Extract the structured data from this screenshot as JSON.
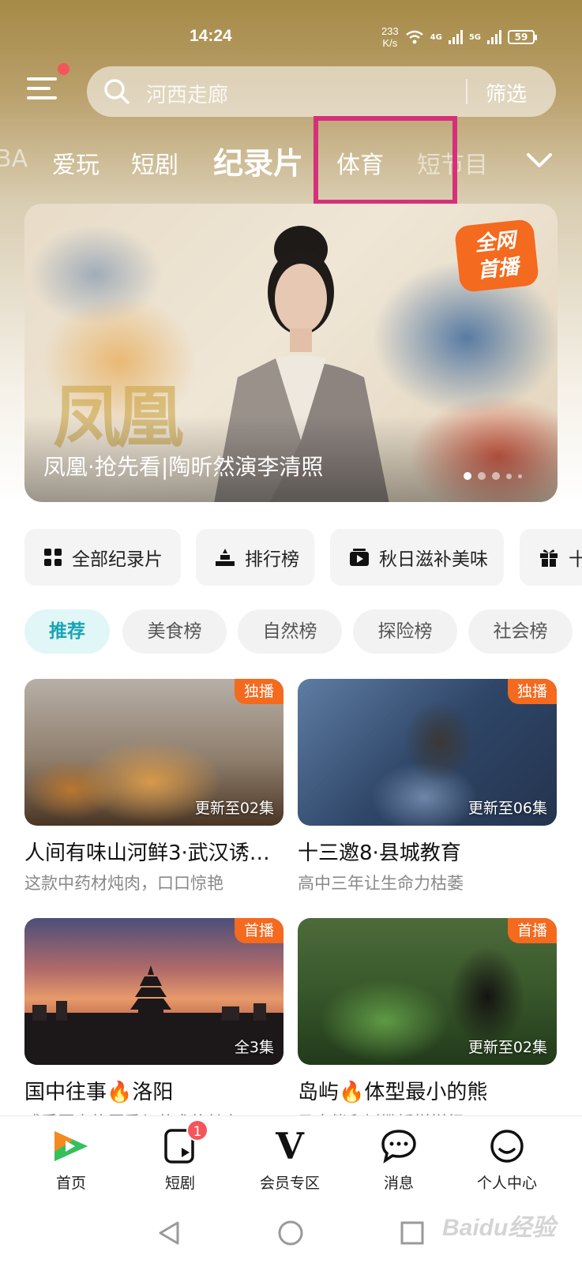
{
  "status_bar": {
    "time": "14:24",
    "net_speed_value": "233",
    "net_speed_unit": "K/s",
    "sig1_label": "4G",
    "sig2_label": "5G",
    "battery": "59"
  },
  "search": {
    "placeholder": "河西走廊",
    "filter_label": "筛选"
  },
  "tabs": [
    {
      "label": "BA"
    },
    {
      "label": "爱玩"
    },
    {
      "label": "短剧"
    },
    {
      "label": "纪录片",
      "active": true
    },
    {
      "label": "体育"
    },
    {
      "label": "短节目"
    }
  ],
  "banner": {
    "calligraphy": "凤凰",
    "badge_line1": "全网",
    "badge_line2": "首播",
    "caption": "凤凰·抢先看|陶昕然演李清照",
    "page_count": 5,
    "current_page": 1
  },
  "quick_entries": [
    {
      "label": "全部纪录片",
      "icon": "grid-icon"
    },
    {
      "label": "排行榜",
      "icon": "podium-icon"
    },
    {
      "label": "秋日滋补美味",
      "icon": "play-box-icon"
    },
    {
      "label": "十",
      "icon": "gift-icon"
    }
  ],
  "rank_chips": [
    {
      "label": "推荐",
      "active": true
    },
    {
      "label": "美食榜"
    },
    {
      "label": "自然榜"
    },
    {
      "label": "探险榜"
    },
    {
      "label": "社会榜"
    }
  ],
  "cards": [
    {
      "tag": "独播",
      "episode": "更新至02集",
      "title": "人间有味山河鲜3·武汉诱…",
      "subtitle": "这款中药材炖肉，口口惊艳"
    },
    {
      "tag": "独播",
      "episode": "更新至06集",
      "title": "十三邀8·县城教育",
      "subtitle": "高中三年让生命力枯萎"
    },
    {
      "tag": "首播",
      "episode": "全3集",
      "title_a": "国中往事",
      "title_b": "洛阳",
      "subtitle": "感受历史的厚重与艺术的魅力"
    },
    {
      "tag": "首播",
      "episode": "更新至02集",
      "title_a": "岛屿",
      "title_b": "体型最小的熊",
      "subtitle": "马来熊爬树撒娇样样行"
    }
  ],
  "bottom_nav": [
    {
      "label": "首页",
      "icon": "home-logo-icon"
    },
    {
      "label": "短剧",
      "icon": "short-drama-icon",
      "badge": "1"
    },
    {
      "label": "会员专区",
      "icon": "vip-v-icon",
      "glyph": "V"
    },
    {
      "label": "消息",
      "icon": "message-icon"
    },
    {
      "label": "个人中心",
      "icon": "profile-icon"
    }
  ],
  "watermark": "Baidu经验",
  "colors": {
    "accent_orange": "#f46a1e",
    "active_chip_text": "#17a5b6",
    "active_chip_bg": "#e1f6f6",
    "highlight": "#d6307a",
    "badge_red": "#f4555b"
  }
}
